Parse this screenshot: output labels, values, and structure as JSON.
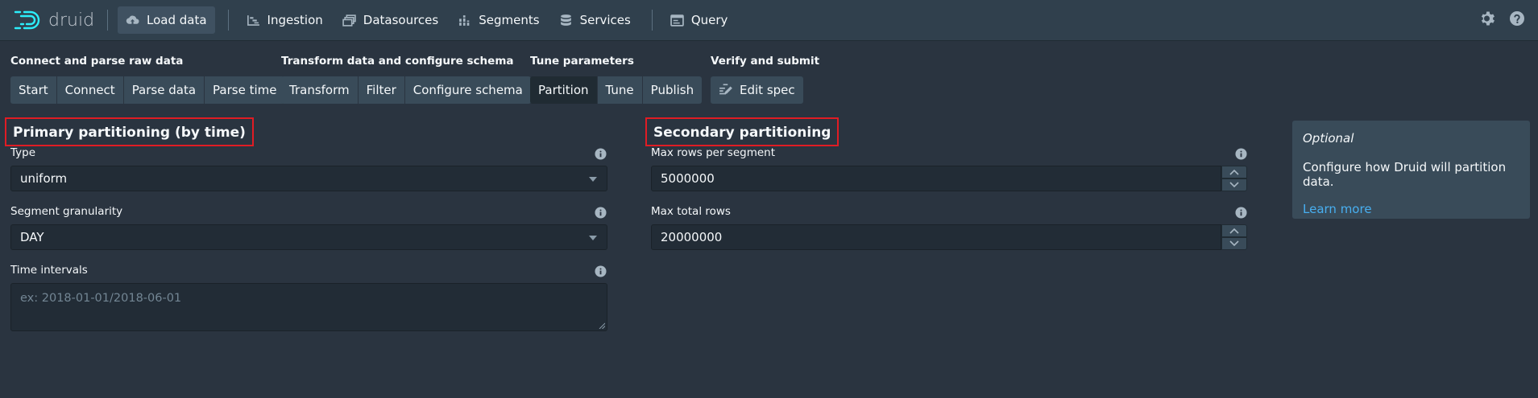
{
  "nav": {
    "logo_text": "druid",
    "items": [
      {
        "label": "Load data",
        "icon": "cloud-upload-icon",
        "active": true
      },
      {
        "label": "Ingestion",
        "icon": "gantt-chart-icon"
      },
      {
        "label": "Datasources",
        "icon": "multi-select-icon"
      },
      {
        "label": "Segments",
        "icon": "stacked-chart-icon"
      },
      {
        "label": "Services",
        "icon": "database-icon"
      },
      {
        "label": "Query",
        "icon": "application-icon"
      }
    ],
    "right_icons": [
      "cog-icon",
      "help-icon"
    ]
  },
  "steps": [
    {
      "title": "Connect and parse raw data",
      "buttons": [
        "Start",
        "Connect",
        "Parse data",
        "Parse time"
      ]
    },
    {
      "title": "Transform data and configure schema",
      "buttons": [
        "Transform",
        "Filter",
        "Configure schema"
      ]
    },
    {
      "title": "Tune parameters",
      "buttons": [
        "Partition",
        "Tune",
        "Publish"
      ],
      "active": "Partition"
    },
    {
      "title": "Verify and submit",
      "buttons": [
        "Edit spec"
      ]
    }
  ],
  "primary": {
    "heading": "Primary partitioning (by time)",
    "type_label": "Type",
    "type_value": "uniform",
    "granularity_label": "Segment granularity",
    "granularity_value": "DAY",
    "intervals_label": "Time intervals",
    "intervals_placeholder": "ex: 2018-01-01/2018-06-01"
  },
  "secondary": {
    "heading": "Secondary partitioning",
    "max_rows_label": "Max rows per segment",
    "max_rows_value": "5000000",
    "max_total_label": "Max total rows",
    "max_total_value": "20000000"
  },
  "callout": {
    "title": "Optional",
    "text": "Configure how Druid will partition data.",
    "link": "Learn more"
  },
  "colors": {
    "background": "#2a3440",
    "navbar": "#30404d",
    "highlight_border": "#e01c24",
    "link": "#48aff0"
  }
}
